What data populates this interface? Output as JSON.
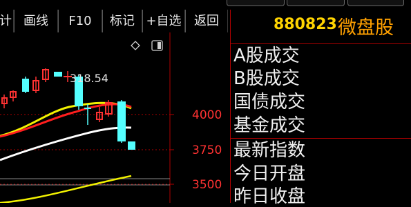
{
  "toolbar": {
    "buttons": [
      {
        "label": "计"
      },
      {
        "label": "画线"
      },
      {
        "label": "F10"
      },
      {
        "label": "标记"
      },
      {
        "label": "+自选"
      },
      {
        "label": "返回"
      }
    ]
  },
  "chart_panel": {
    "price_tag": "318.54",
    "icons": [
      "diamond-icon",
      "window-icon"
    ],
    "axis_labels": [
      "4000",
      "3750",
      "3500"
    ]
  },
  "quote": {
    "code": "880823",
    "name": "微盘股",
    "labels": [
      "A股成交",
      "B股成交",
      "国债成交",
      "基金成交",
      "最新指数",
      "今日开盘",
      "昨日收盘"
    ]
  },
  "colors": {
    "background": "#000000",
    "up": "#ff3232",
    "down": "#54ffff",
    "grid": "#b00000",
    "code": "#ffd400",
    "name": "#ffa000"
  }
}
